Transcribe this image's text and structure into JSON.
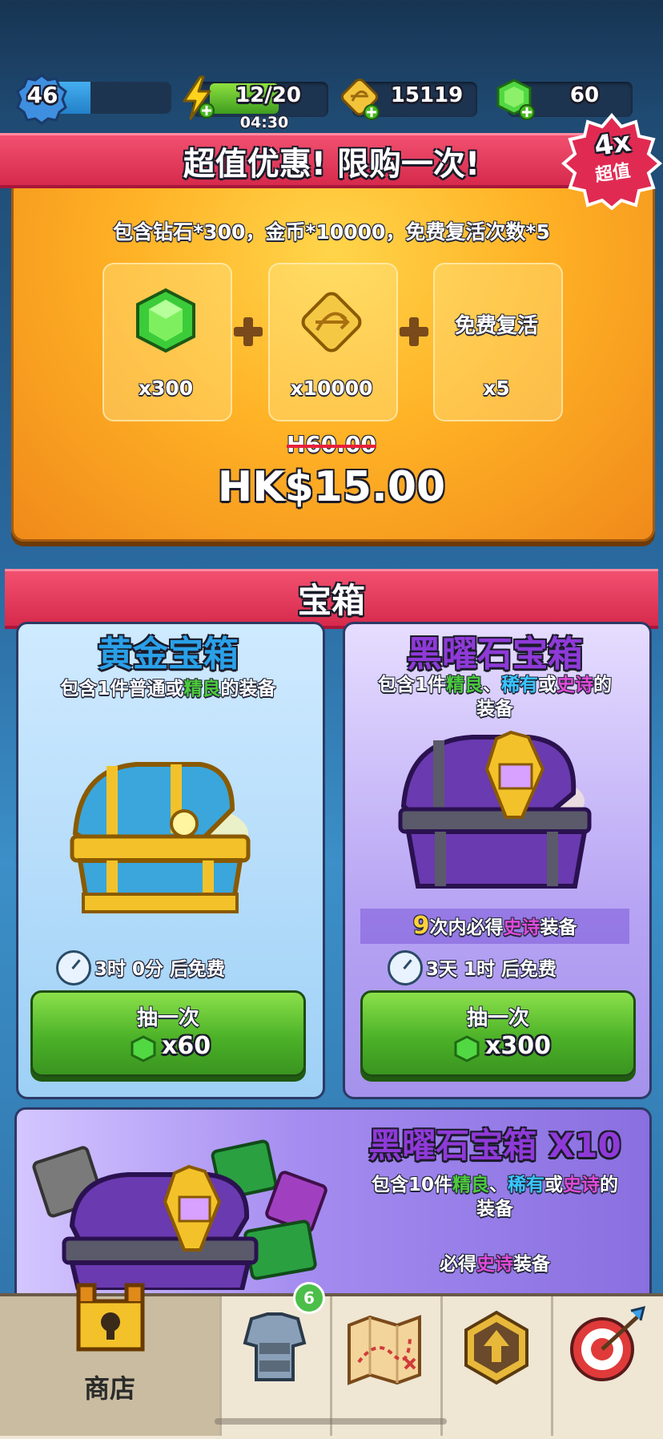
{
  "top_bar": {
    "level": "46",
    "xp_fill": 0.32,
    "energy": "12/20",
    "energy_fill": 0.6,
    "energy_timer": "04:30",
    "gold": "15119",
    "gems": "60"
  },
  "offer": {
    "title": "超值优惠! 限购一次!",
    "badge_multiplier": "4x",
    "badge_label": "超值",
    "description": "包含钻石*300，金币*10000，免费复活次数*5",
    "items": [
      {
        "label": "x300",
        "icon": "gem-icon"
      },
      {
        "label": "x10000",
        "icon": "gold-coin-icon"
      },
      {
        "name": "免费复活",
        "label": "x5"
      }
    ],
    "old_price": "H60.00",
    "price": "HK$15.00"
  },
  "chests_section": {
    "title": "宝箱",
    "gold_chest": {
      "title": "黄金宝箱",
      "desc_prefix": "包含1件普通或",
      "desc_highlight": "精良",
      "desc_suffix": "的装备",
      "timer": "3时 0分 后免费",
      "button_label": "抽一次",
      "button_cost": "x60"
    },
    "obsidian_chest": {
      "title": "黑曜石宝箱",
      "desc_line1_a": "包含1件",
      "desc_line1_b": "精良",
      "desc_line1_c": "、",
      "desc_line1_d": "稀有",
      "desc_line1_e": "或",
      "desc_line1_f": "史诗",
      "desc_line1_g": "的",
      "desc_line2": "装备",
      "guarantee_num": "9",
      "guarantee_a": "次内必得",
      "guarantee_b": "史诗",
      "guarantee_c": "装备",
      "timer": "3天 1时 后免费",
      "button_label": "抽一次",
      "button_cost": "x300"
    },
    "obsidian_x10": {
      "title": "黑曜石宝箱",
      "multiplier": "X10",
      "desc_a": "包含10件",
      "desc_b": "精良",
      "desc_c": "、",
      "desc_d": "稀有",
      "desc_e": "或",
      "desc_f": "史诗",
      "desc_g": "的",
      "desc_line2": "装备",
      "guarantee_a": "必得",
      "guarantee_b": "史诗",
      "guarantee_c": "装备"
    }
  },
  "bottom_nav": {
    "shop_label": "商店",
    "equipment_badge": "6"
  },
  "colors": {
    "uncommon_green": "#3aa02a",
    "rare_blue": "#2a8ad8",
    "epic_purple": "#c23ad0",
    "banner_red": "#e03a5a",
    "button_green": "#4cb228"
  }
}
